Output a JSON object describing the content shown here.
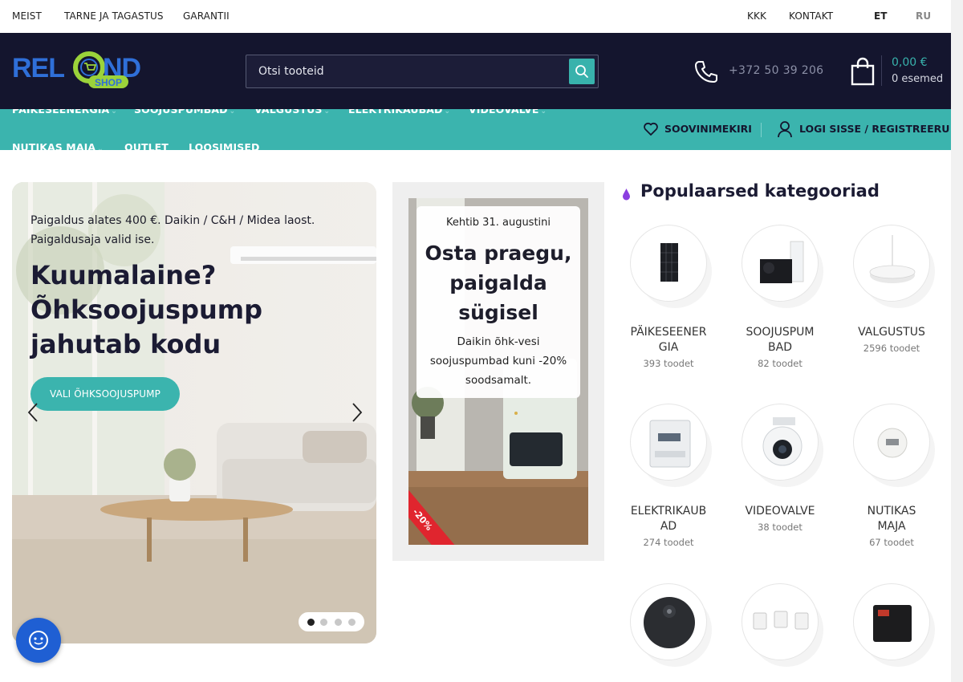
{
  "topbar": {
    "links_left": [
      "MEIST",
      "TARNE JA TAGASTUS",
      "GARANTII"
    ],
    "links_right": [
      "KKK",
      "KONTAKT"
    ],
    "lang_active": "ET",
    "lang_other": "RU"
  },
  "header": {
    "logo_text": "RELOND",
    "logo_sub": "SHOP",
    "search_placeholder": "Otsi tooteid",
    "phone": "+372 50 39 206",
    "cart_total": "0,00 €",
    "cart_items": "0 esemed"
  },
  "nav": {
    "items": [
      "PÄIKESEENERGIA",
      "SOOJUSPUMBAD",
      "VALGUSTUS",
      "ELEKTRIKAUBAD",
      "VIDEOVALVE",
      "NUTIKAS MAJA",
      "OUTLET",
      "LOOSIMISED"
    ],
    "wishlist": "SOOVINIMEKIRI",
    "login": "LOGI SISSE / REGISTREERU"
  },
  "hero": {
    "kicker_line1": "Paigaldus alates 400 €. Daikin / C&H / Midea laost.",
    "kicker_line2": "Paigaldusaja valid ise.",
    "title": "Kuumalaine? Õhksoojuspump jahutab kodu",
    "button": "VALI ÕHKSOOJUSPUMP",
    "slides_total": 4,
    "slide_active": 1
  },
  "promo": {
    "kicker": "Kehtib 31. augustini",
    "title": "Osta praegu, paigalda sügisel",
    "description": "Daikin õhk-vesi soojuspumbad kuni -20% soodsamalt.",
    "badge": "-20%"
  },
  "categories": {
    "heading": "Populaarsed kategooriad",
    "accent_color": "#8b3fe0",
    "items": [
      {
        "name_line1": "PÄIKESEENER",
        "name_line2": "GIA",
        "count": "393 toodet",
        "icon": "solar-panel-icon"
      },
      {
        "name_line1": "SOOJUSPUM",
        "name_line2": "BAD",
        "count": "82 toodet",
        "icon": "heat-pump-icon"
      },
      {
        "name_line1": "VALGUSTUS",
        "name_line2": "",
        "count": "2596 toodet",
        "icon": "ceiling-light-icon"
      },
      {
        "name_line1": "ELEKTRIKAUB",
        "name_line2": "AD",
        "count": "274 toodet",
        "icon": "electric-meter-icon"
      },
      {
        "name_line1": "VIDEOVALVE",
        "name_line2": "",
        "count": "38 toodet",
        "icon": "security-camera-icon"
      },
      {
        "name_line1": "NUTIKAS",
        "name_line2": "MAJA",
        "count": "67 toodet",
        "icon": "smart-sensor-icon"
      },
      {
        "name_line1": "",
        "name_line2": "",
        "count": "",
        "icon": "robot-vacuum-icon"
      },
      {
        "name_line1": "",
        "name_line2": "",
        "count": "",
        "icon": "smart-plugs-icon"
      },
      {
        "name_line1": "",
        "name_line2": "",
        "count": "",
        "icon": "gaming-monitor-icon"
      }
    ]
  },
  "colors": {
    "header_bg": "#14152e",
    "nav_bg": "#3bb4ae",
    "accent": "#3bb4ae"
  }
}
